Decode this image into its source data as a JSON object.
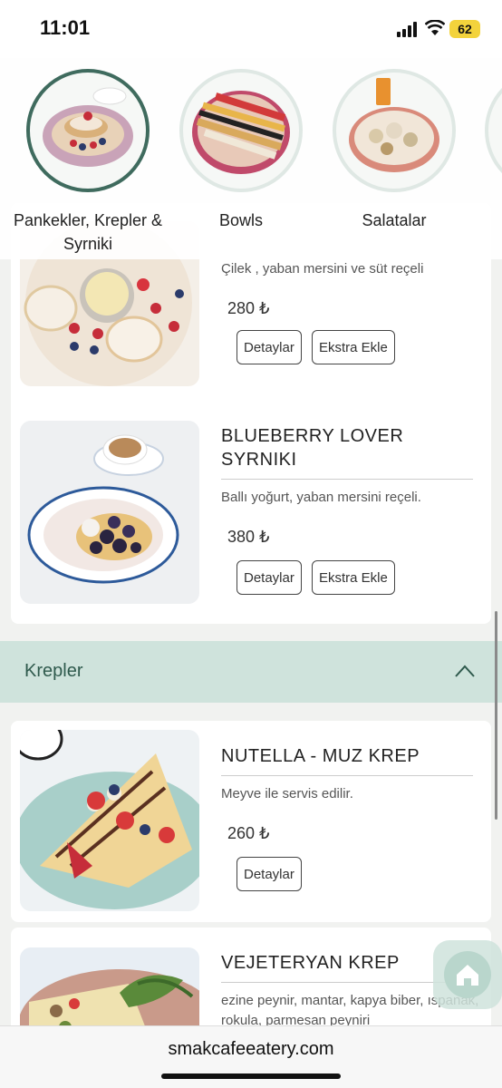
{
  "status_bar": {
    "time": "11:01",
    "battery": "62"
  },
  "categories": [
    {
      "label": "Pankekler, Krepler & Syrniki",
      "active": true
    },
    {
      "label": "Bowls",
      "active": false
    },
    {
      "label": "Salatalar",
      "active": false
    }
  ],
  "items": [
    {
      "name": "",
      "description": "Çilek , yaban mersini ve süt reçeli",
      "price": "280 ₺",
      "buttons": [
        "Detaylar",
        "Ekstra Ekle"
      ]
    },
    {
      "name": "BLUEBERRY LOVER SYRNIKI",
      "description": "Ballı yoğurt, yaban mersini reçeli.",
      "price": "380 ₺",
      "buttons": [
        "Detaylar",
        "Ekstra Ekle"
      ]
    },
    {
      "name": "NUTELLA - MUZ KREP",
      "description": "Meyve ile servis edilir.",
      "price": "260 ₺",
      "buttons": [
        "Detaylar"
      ]
    },
    {
      "name": "VEJETERYAN KREP",
      "description": "ezine peynir, mantar, kapya biber, ıspanak, rokula, parmesan peyniri",
      "price": "",
      "buttons": []
    }
  ],
  "section": {
    "title": "Krepler"
  },
  "browser": {
    "url": "smakcafeeatery.com"
  },
  "colors": {
    "accent": "#3f6b5e",
    "section_bg": "#cfe3dc"
  }
}
